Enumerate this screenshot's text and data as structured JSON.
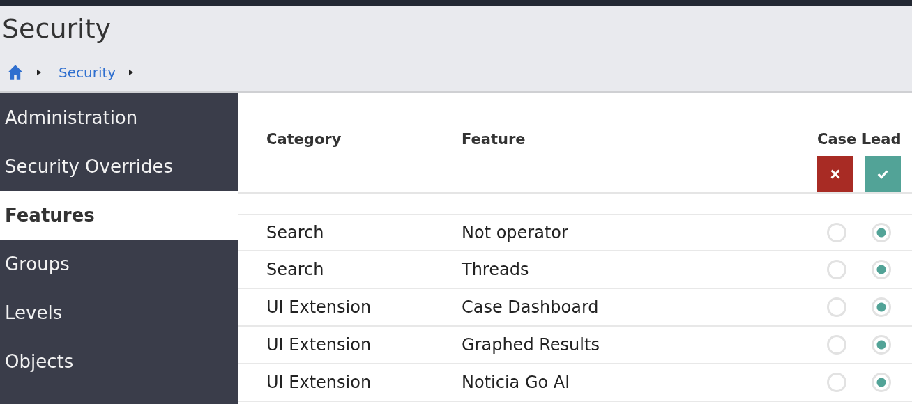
{
  "page_title": "Security",
  "breadcrumb": [
    {
      "kind": "home"
    },
    {
      "kind": "link",
      "label": "Security"
    }
  ],
  "sidebar": {
    "items": [
      {
        "label": "Administration",
        "selected": false
      },
      {
        "label": "Security Overrides",
        "selected": false
      },
      {
        "label": "Features",
        "selected": true
      },
      {
        "label": "Groups",
        "selected": false
      },
      {
        "label": "Levels",
        "selected": false
      },
      {
        "label": "Objects",
        "selected": false
      }
    ]
  },
  "table": {
    "columns": [
      "Category",
      "Feature",
      "Case Lead"
    ],
    "header_buttons": [
      {
        "kind": "deny"
      },
      {
        "kind": "allow"
      }
    ],
    "rows": [
      {
        "category": "Search",
        "feature": "Not operator",
        "options": [
          {
            "selected": false
          },
          {
            "selected": true
          }
        ]
      },
      {
        "category": "Search",
        "feature": "Threads",
        "options": [
          {
            "selected": false
          },
          {
            "selected": true
          }
        ]
      },
      {
        "category": "UI Extension",
        "feature": "Case Dashboard",
        "options": [
          {
            "selected": false
          },
          {
            "selected": true
          }
        ]
      },
      {
        "category": "UI Extension",
        "feature": "Graphed Results",
        "options": [
          {
            "selected": false
          },
          {
            "selected": true
          }
        ]
      },
      {
        "category": "UI Extension",
        "feature": "Noticia Go AI",
        "options": [
          {
            "selected": false
          },
          {
            "selected": true
          }
        ]
      }
    ]
  }
}
